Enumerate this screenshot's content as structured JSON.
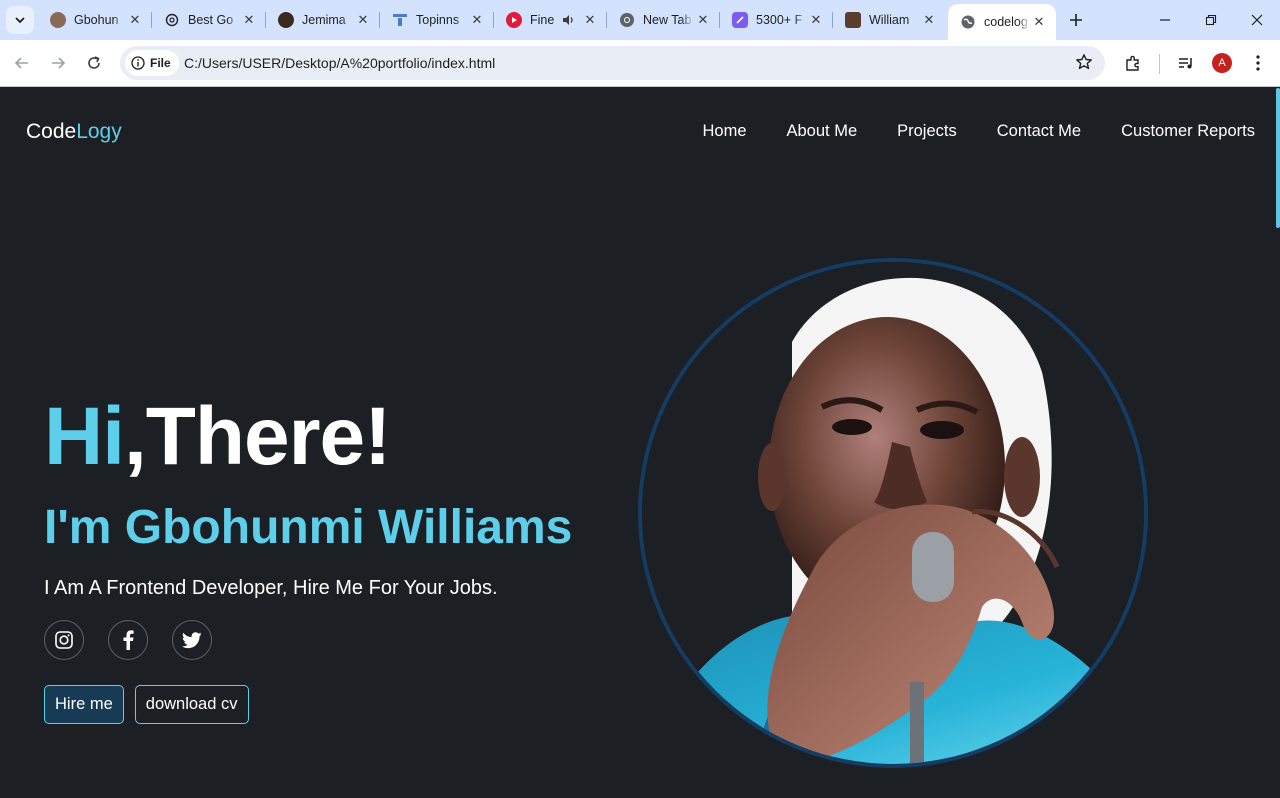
{
  "browser": {
    "tabs": [
      {
        "title": "Gbohun",
        "favicon": "user-avatar-icon",
        "active": false
      },
      {
        "title": "Best Go",
        "favicon": "openai-icon",
        "active": false
      },
      {
        "title": "Jemima",
        "favicon": "user-avatar-icon",
        "active": false
      },
      {
        "title": "Topinns",
        "favicon": "topinns-icon",
        "active": false
      },
      {
        "title": "Fine",
        "favicon": "youtube-music-icon",
        "active": false,
        "audio": true
      },
      {
        "title": "New Tab",
        "favicon": "chrome-icon",
        "active": false
      },
      {
        "title": "5300+ F",
        "favicon": "app-icon",
        "active": false
      },
      {
        "title": "William",
        "favicon": "user-avatar-icon",
        "active": false
      },
      {
        "title": "codelog",
        "favicon": "globe-icon",
        "active": true
      }
    ],
    "address": {
      "chip_label": "File",
      "url": "C:/Users/USER/Desktop/A%20portfolio/index.html"
    },
    "profile_initial": "A"
  },
  "site": {
    "logo_part1": "Code",
    "logo_part2": "Logy",
    "nav": [
      "Home",
      "About Me",
      "Projects",
      "Contact Me",
      "Customer Reports"
    ],
    "hero": {
      "greet_highlight": "Hi",
      "greet_rest": ",There!",
      "name": "I'm Gbohunmi Williams",
      "tagline": "I Am A Frontend Developer, Hire Me For Your Jobs."
    },
    "socials": [
      "instagram-icon",
      "facebook-icon",
      "twitter-icon"
    ],
    "buttons": {
      "hire": "Hire me",
      "download": "download cv"
    }
  },
  "colors": {
    "accent": "#5ecfea",
    "page_bg": "#1c1f24",
    "ring": "#153c62",
    "button_fill": "#173a55"
  }
}
